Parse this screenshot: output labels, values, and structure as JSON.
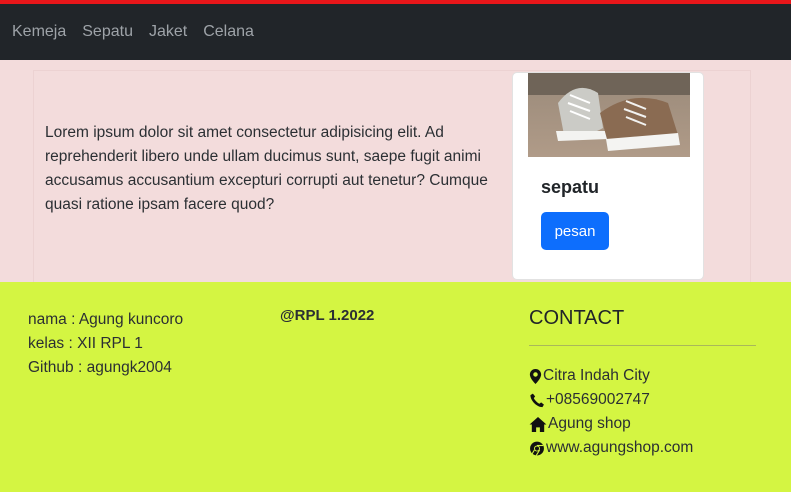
{
  "nav": {
    "items": [
      "Kemeja",
      "Sepatu",
      "Jaket",
      "Celana"
    ]
  },
  "main": {
    "lorem": "Lorem ipsum dolor sit amet consectetur adipisicing elit. Ad reprehenderit libero unde ullam ducimus sunt, saepe fugit animi accusamus accusantium excepturi corrupti aut tenetur? Cumque quasi ratione ipsam facere quod?"
  },
  "card": {
    "title": "sepatu",
    "button_label": "pesan",
    "image_icon": "shoe-photo"
  },
  "footer": {
    "info": [
      "nama : Agung kuncoro",
      "kelas : XII RPL 1",
      "Github : agungk2004"
    ],
    "copyright": "@RPL 1.2022",
    "contact_title": "CONTACT",
    "contacts": [
      {
        "icon": "location-pin-icon",
        "text": "Citra Indah City"
      },
      {
        "icon": "phone-icon",
        "text": "+08569002747"
      },
      {
        "icon": "home-icon",
        "text": "Agung shop"
      },
      {
        "icon": "chrome-icon",
        "text": "www.agungshop.com"
      }
    ]
  },
  "colors": {
    "topbar": "#212529",
    "topbar_accent": "#e8161a",
    "content_bg": "#f3dcdc",
    "footer_bg": "#d4f542",
    "button": "#0d6efd"
  }
}
